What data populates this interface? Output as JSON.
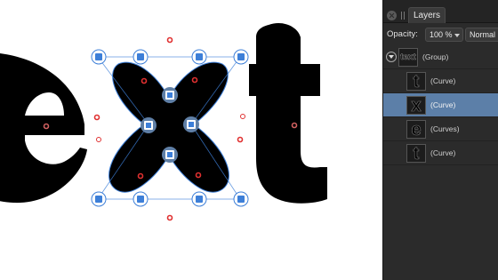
{
  "canvas": {
    "glyphs": [
      {
        "char": "e"
      },
      {
        "char": "x"
      },
      {
        "char": "t"
      }
    ],
    "selection_color": "#3d7fd8",
    "control_color": "#e03030"
  },
  "layers_panel": {
    "tab_label": "Layers",
    "opacity_label": "Opacity:",
    "opacity_value": "100 %",
    "blend_mode": "Normal",
    "rows": [
      {
        "thumb": "text",
        "name": "(Group)",
        "selected": false
      },
      {
        "thumb": "t",
        "name": "(Curve)",
        "selected": false
      },
      {
        "thumb": "x",
        "name": "(Curve)",
        "selected": true
      },
      {
        "thumb": "e",
        "name": "(Curves)",
        "selected": false
      },
      {
        "thumb": "t",
        "name": "(Curve)",
        "selected": false
      }
    ]
  }
}
